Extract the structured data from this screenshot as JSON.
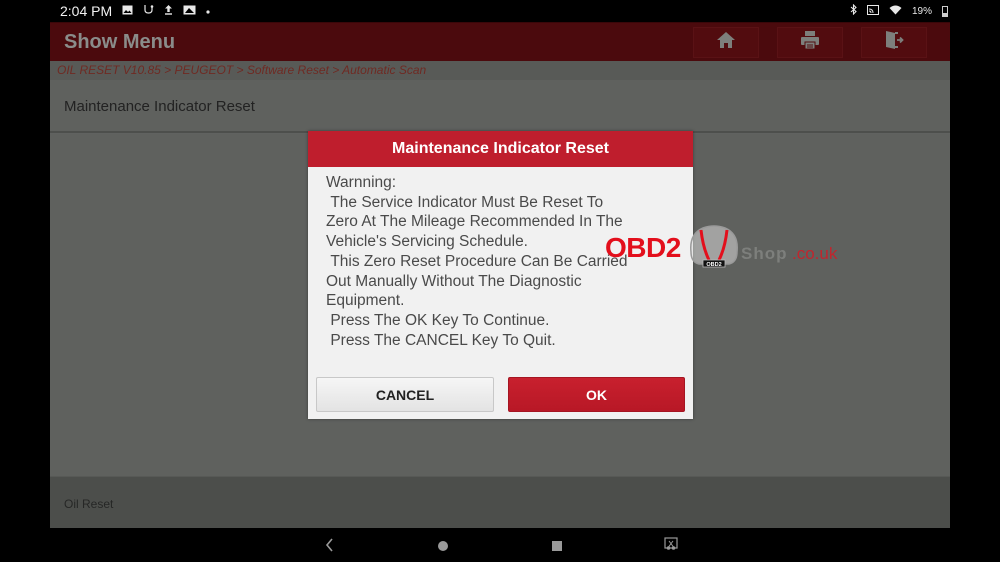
{
  "status_bar": {
    "time": "2:04 PM",
    "left_icons": [
      "image-icon",
      "usb-icon",
      "upload-icon",
      "photo-icon",
      "dot-icon"
    ],
    "right_icons": [
      "bluetooth-icon",
      "cast-icon",
      "wifi-icon",
      "battery-icon"
    ],
    "battery_percent": "19%"
  },
  "header": {
    "title": "Show Menu",
    "buttons": [
      {
        "name": "home",
        "icon": "home-icon"
      },
      {
        "name": "print",
        "icon": "printer-icon"
      },
      {
        "name": "exit",
        "icon": "exit-icon"
      }
    ]
  },
  "breadcrumb": {
    "text": "OIL RESET V10.85 > PEUGEOT > Software Reset > Automatic Scan",
    "items": [
      "OIL RESET V10.85",
      "PEUGEOT",
      "Software Reset",
      "Automatic Scan"
    ]
  },
  "section": {
    "title": "Maintenance Indicator Reset"
  },
  "footer": {
    "text": "Oil Reset"
  },
  "dialog": {
    "title": "Maintenance Indicator Reset",
    "body": "Warnning:\n The Service Indicator Must Be Reset To\nZero At The Mileage Recommended In The\nVehicle's Servicing Schedule.\n This Zero Reset Procedure Can Be Carried\nOut Manually Without The Diagnostic\nEquipment.\n Press The OK Key To Continue.\n Press The CANCEL Key To Quit.",
    "cancel_label": "CANCEL",
    "ok_label": "OK",
    "accent_color": "#bf1e2d"
  },
  "watermark": {
    "brand": "OBD2",
    "plate": "OBD2",
    "shop": "Shop",
    "domain": ".co.uk"
  },
  "nav_bar": {
    "buttons": [
      "back-icon",
      "home-circle-icon",
      "recent-apps-icon",
      "screenshot-icon"
    ]
  },
  "colors": {
    "header_bg": "#4b0a0d",
    "dialog_header": "#bf1e2d",
    "ok_button": "#bf1e2d",
    "overlay_bg": "#5f615e"
  }
}
